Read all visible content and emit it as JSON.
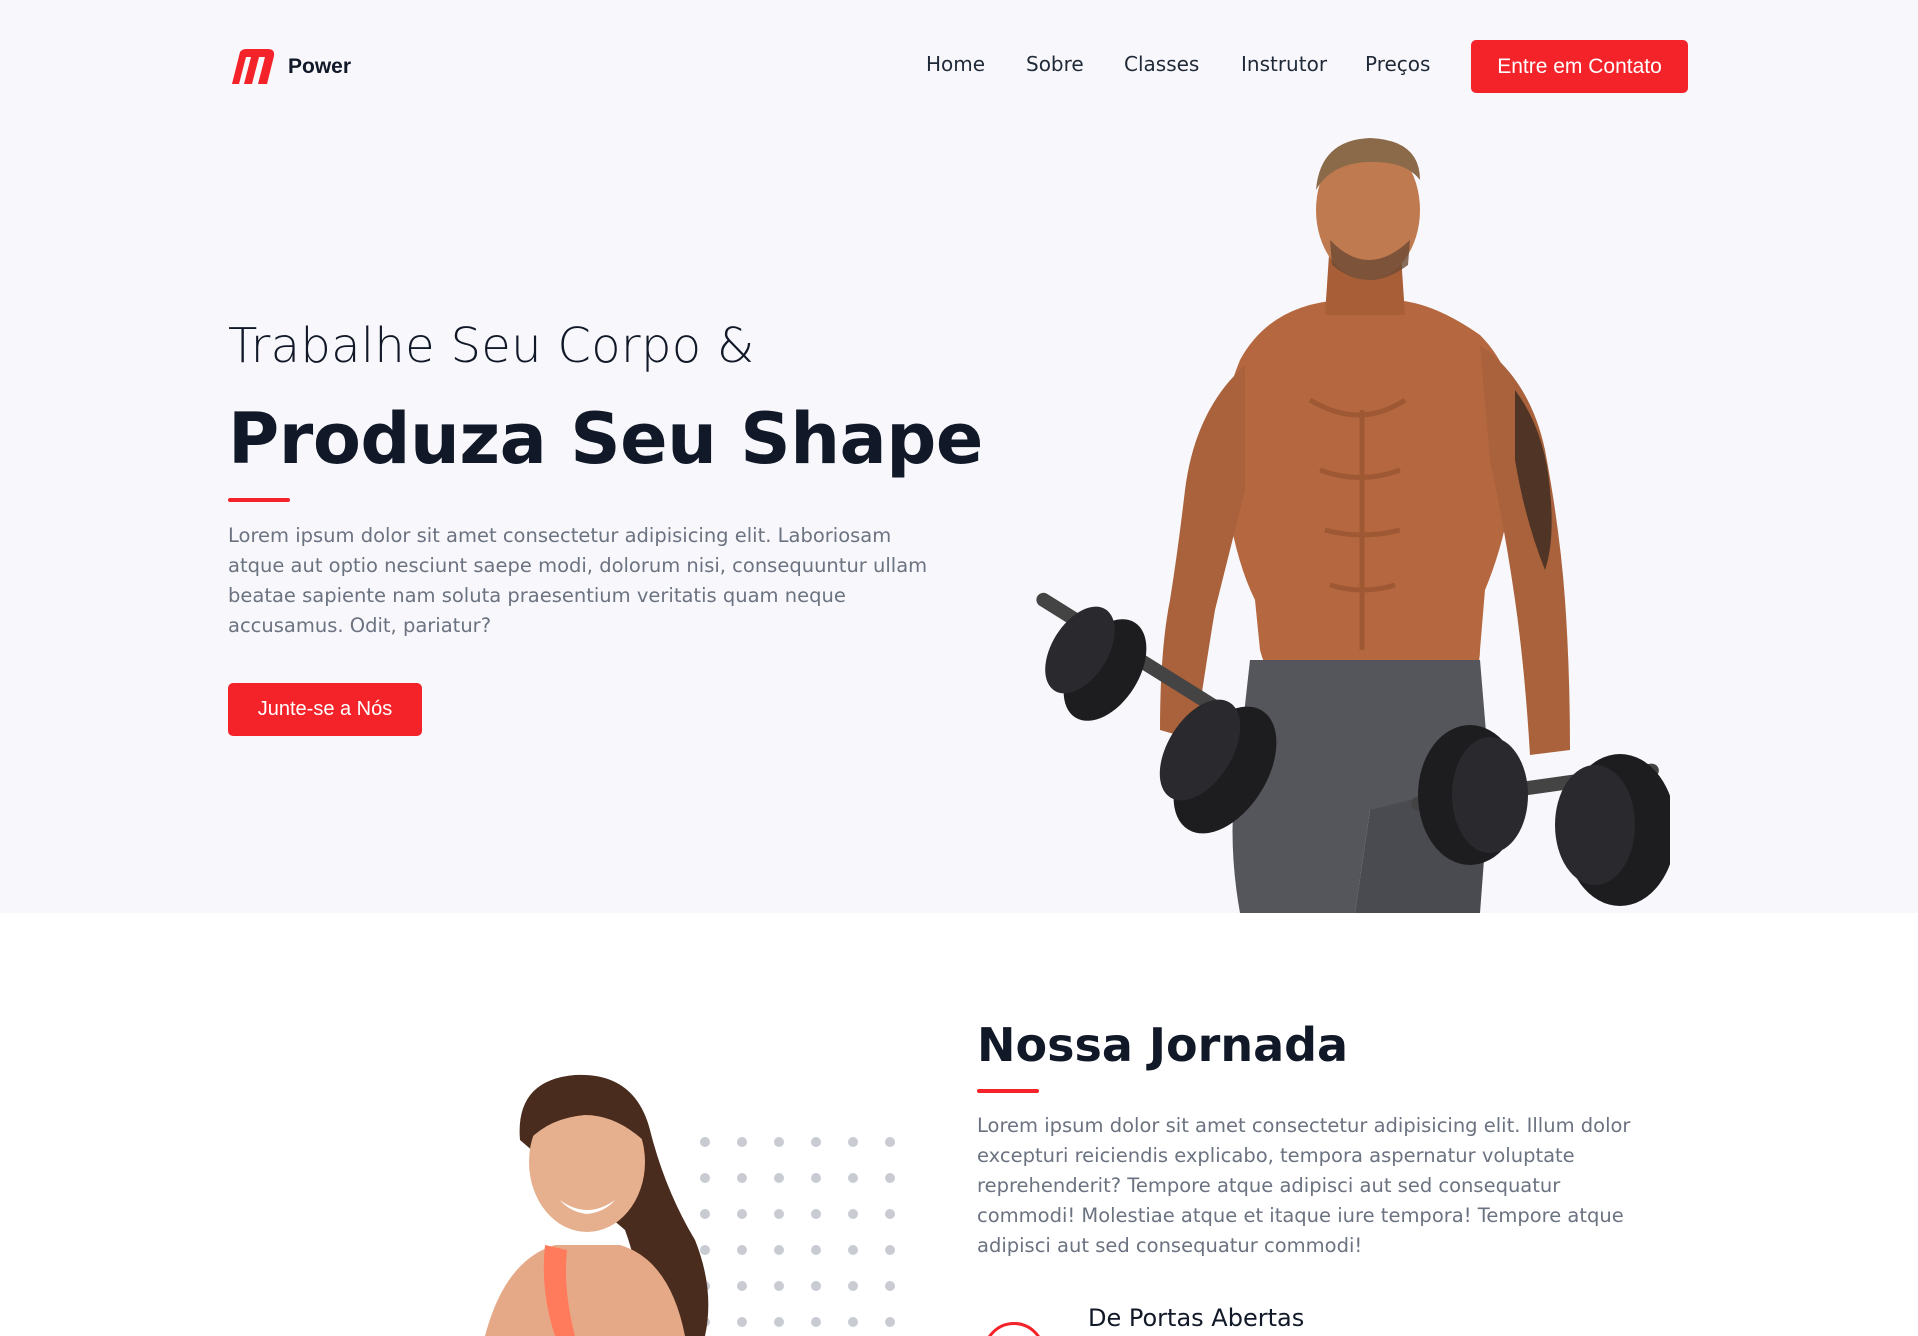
{
  "brand": {
    "name": "Power",
    "accent": "#f4232a",
    "dark": "#111827",
    "muted": "#6b7280"
  },
  "nav": {
    "items": [
      {
        "label": "Home"
      },
      {
        "label": "Sobre"
      },
      {
        "label": "Classes"
      },
      {
        "label": "Instrutor"
      },
      {
        "label": "Preços"
      }
    ],
    "cta_label": "Entre em Contato"
  },
  "hero": {
    "subtitle": "Trabalhe Seu Corpo &",
    "title": "Produza Seu Shape",
    "paragraph": "Lorem ipsum dolor sit amet consectetur adipisicing elit. Laboriosam atque aut optio nesciunt saepe modi, dolorum nisi, consequuntur ullam beatae sapiente nam soluta praesentium veritatis quam neque accusamus. Odit, pariatur?",
    "button_label": "Junte-se a Nós",
    "image": "man-with-dumbbells-photo"
  },
  "journey": {
    "title": "Nossa Jornada",
    "paragraph": "Lorem ipsum dolor sit amet consectetur adipisicing elit. Illum dolor excepturi reiciendis explicabo, tempora aspernatur voluptate reprehenderit? Tempore atque adipisci aut sed consequatur commodi! Molestiae atque et itaque iure tempora! Tempore atque adipisci aut sed consequatur commodi!",
    "image": "smiling-woman-photo",
    "features": [
      {
        "title": "De Portas Abertas",
        "icon": "door-icon"
      }
    ]
  }
}
